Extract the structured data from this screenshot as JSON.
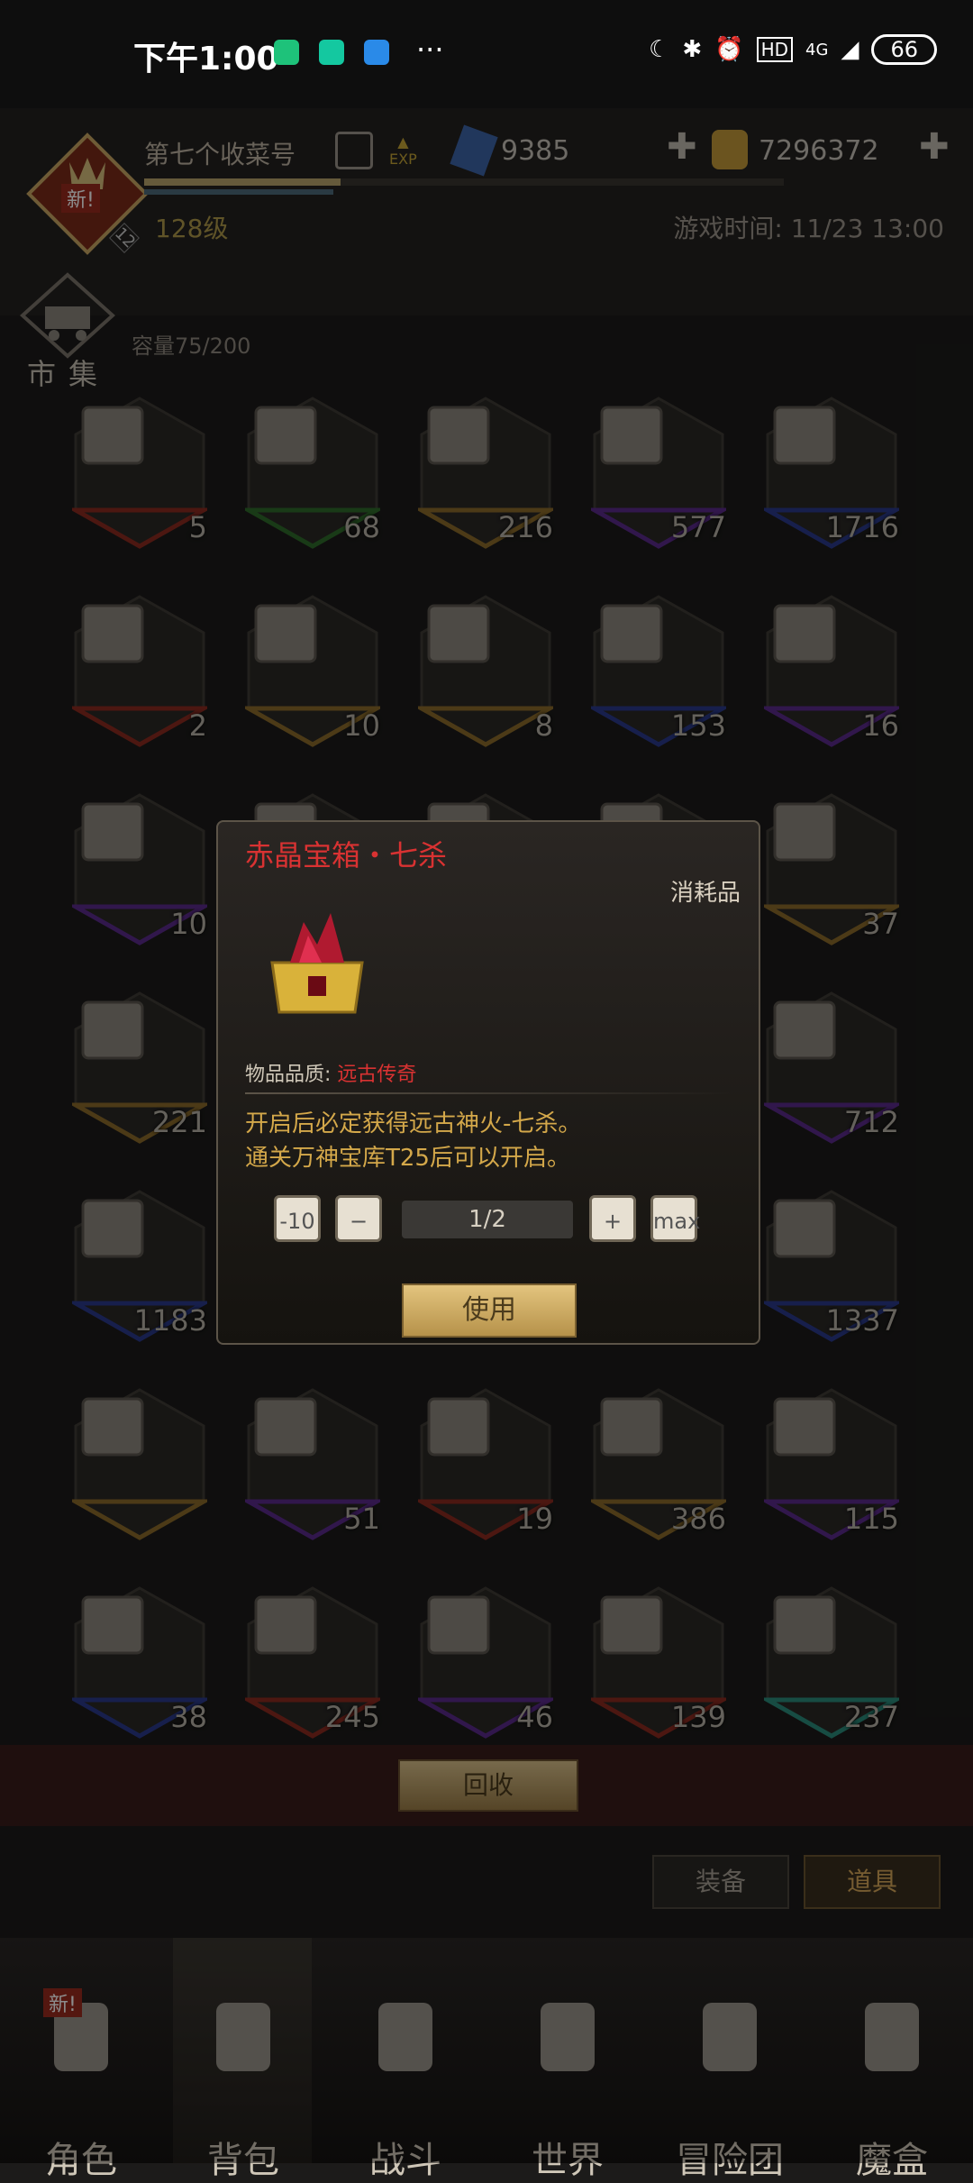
{
  "status_bar": {
    "time": "下午1:00",
    "network": "4G",
    "battery": "66",
    "hd": "HD",
    "more": "···"
  },
  "header": {
    "player_name": "第七个收菜号",
    "level": "128级",
    "game_time": "游戏时间: 11/23 13:00",
    "diamonds": "9385",
    "gold": "7296372",
    "exp_label": "EXP",
    "new_badge": "新!",
    "avatar_level": "12"
  },
  "market": {
    "label": "市集",
    "capacity": "容量75/200"
  },
  "grid": {
    "rows": [
      [
        {
          "count": "5",
          "rim": "#8a2a20"
        },
        {
          "count": "68",
          "rim": "#2f6a2a"
        },
        {
          "count": "216",
          "rim": "#8a6a2a"
        },
        {
          "count": "577",
          "rim": "#5a2a8a"
        },
        {
          "count": "1716",
          "rim": "#2a3a8a"
        }
      ],
      [
        {
          "count": "2",
          "rim": "#8a2a20"
        },
        {
          "count": "10",
          "rim": "#8a6a2a"
        },
        {
          "count": "8",
          "rim": "#8a6a2a"
        },
        {
          "count": "153",
          "rim": "#2a3a8a"
        },
        {
          "count": "16",
          "rim": "#5a2a8a"
        }
      ],
      [
        {
          "count": "10",
          "rim": "#5a2a8a"
        },
        {
          "count": "",
          "rim": "#5a4a2a"
        },
        {
          "count": "",
          "rim": "#3a3a3a"
        },
        {
          "count": "",
          "rim": "#3a3a3a"
        },
        {
          "count": "37",
          "rim": "#8a6a2a"
        }
      ],
      [
        {
          "count": "221",
          "rim": "#8a6a2a"
        },
        {
          "count": "",
          "rim": "#3a3a3a"
        },
        {
          "count": "",
          "rim": "#3a3a3a"
        },
        {
          "count": "",
          "rim": "#3a3a3a"
        },
        {
          "count": "712",
          "rim": "#5a2a8a"
        }
      ],
      [
        {
          "count": "1183",
          "rim": "#2a3a8a"
        },
        {
          "count": "",
          "rim": "#3a3a3a"
        },
        {
          "count": "",
          "rim": "#3a3a3a"
        },
        {
          "count": "",
          "rim": "#3a3a3a"
        },
        {
          "count": "1337",
          "rim": "#2a3a8a"
        }
      ],
      [
        {
          "count": "",
          "rim": "#8a6a2a"
        },
        {
          "count": "51",
          "rim": "#5a2a8a"
        },
        {
          "count": "19",
          "rim": "#8a2a20"
        },
        {
          "count": "386",
          "rim": "#8a6a2a"
        },
        {
          "count": "115",
          "rim": "#5a2a8a"
        }
      ],
      [
        {
          "count": "38",
          "rim": "#2a3a8a"
        },
        {
          "count": "245",
          "rim": "#8a2a20"
        },
        {
          "count": "46",
          "rim": "#5a2a8a"
        },
        {
          "count": "139",
          "rim": "#8a2a20"
        },
        {
          "count": "237",
          "rim": "#2a8a7a"
        }
      ]
    ]
  },
  "dialog": {
    "title": "赤晶宝箱・七杀",
    "type": "消耗品",
    "quality_label": "物品品质:",
    "quality_value": "远古传奇",
    "desc_line1": "开启后必定获得远古神火-七杀。",
    "desc_line2": "通关万神宝库T25后可以开启。",
    "btn_minus10": "-10",
    "btn_minus": "−",
    "quantity": "1/2",
    "btn_plus": "+",
    "btn_max": "max",
    "use_label": "使用"
  },
  "bottom": {
    "recycle": "回收",
    "tab_equip": "装备",
    "tab_items": "道具"
  },
  "nav": {
    "items": [
      "角色",
      "背包",
      "战斗",
      "世界",
      "冒险团",
      "魔盒"
    ],
    "new_tag": "新!"
  },
  "colors": {
    "accent_gold": "#d4a84a",
    "legendary_red": "#d93232"
  }
}
